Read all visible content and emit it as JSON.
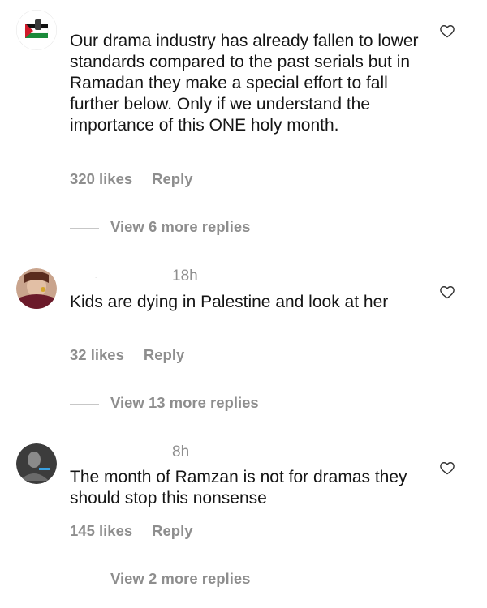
{
  "comments": [
    {
      "avatar_icon": "palestine-flag-fist-icon",
      "time": "",
      "text": "Our drama industry has already fallen to lower standards compared to the past serials but in Ramadan they make a special effort to fall further below. Only if we understand the importance of this ONE holy month.",
      "likes": "320 likes",
      "reply_label": "Reply",
      "more_replies": "View 6 more replies"
    },
    {
      "avatar_icon": "user-photo-avatar",
      "username": ".",
      "time": "18h",
      "text": "Kids are dying in Palestine and look at her",
      "likes": "32 likes",
      "reply_label": "Reply",
      "more_replies": "View 13 more replies"
    },
    {
      "avatar_icon": "user-photo-avatar",
      "time": "8h",
      "text": "The month of Ramzan is not for dramas they should stop this nonsense",
      "likes": "145 likes",
      "reply_label": "Reply",
      "more_replies": "View 2 more replies"
    }
  ],
  "icons": {
    "like": "heart-outline-icon"
  },
  "colors": {
    "text": "#151515",
    "muted": "#8e8e8e",
    "divider": "#c7c7c7"
  }
}
